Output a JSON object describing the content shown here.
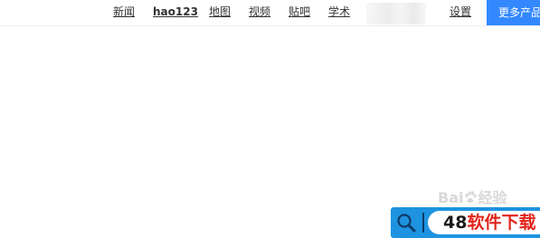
{
  "nav": {
    "items": [
      {
        "label": "新闻"
      },
      {
        "label": "hao123"
      },
      {
        "label": "地图"
      },
      {
        "label": "视频"
      },
      {
        "label": "贴吧"
      },
      {
        "label": "学术"
      }
    ],
    "settings_label": "设置",
    "more_products_label": "更多产品"
  },
  "watermark": {
    "brand_left": "Bai",
    "brand_right": "经验"
  },
  "badge": {
    "number": "48",
    "text": "软件下载",
    "search_icon": "search-icon",
    "colors": {
      "background": "#1e93e0",
      "text": "#e2241b",
      "number": "#1a1a1a"
    }
  },
  "colors": {
    "accent": "#3388ff",
    "link": "#333333"
  }
}
